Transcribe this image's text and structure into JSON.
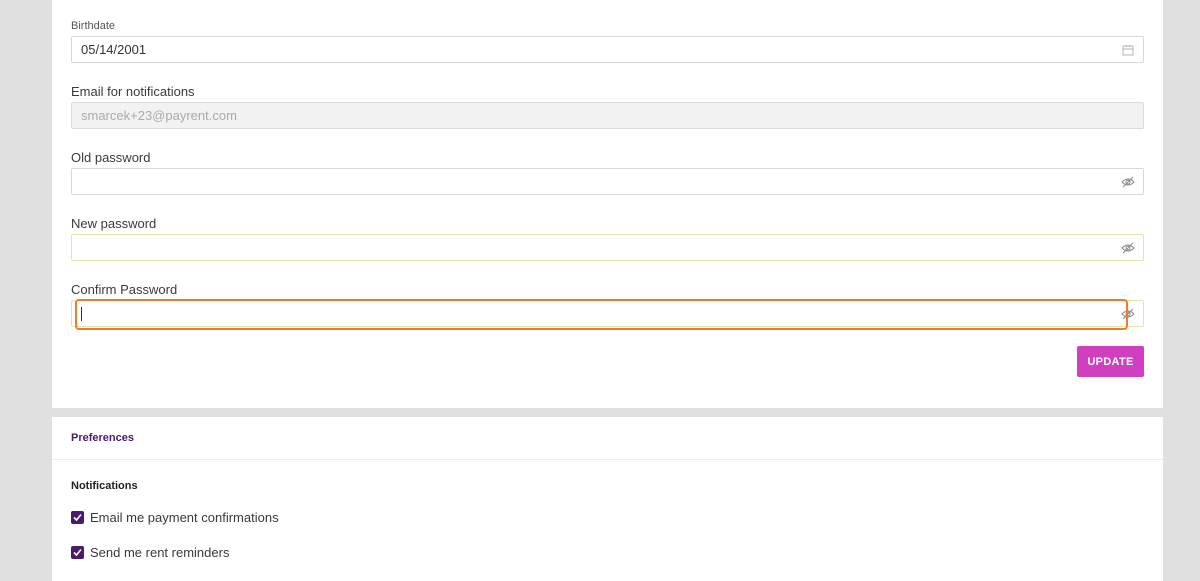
{
  "account_form": {
    "birthdate": {
      "label": "Birthdate",
      "value": "05/14/2001"
    },
    "email": {
      "label": "Email for notifications",
      "value": "smarcek+23@payrent.com"
    },
    "old_password": {
      "label": "Old password",
      "value": ""
    },
    "new_password": {
      "label": "New password",
      "value": ""
    },
    "confirm_password": {
      "label": "Confirm Password",
      "value": ""
    },
    "update_label": "UPDATE"
  },
  "preferences": {
    "title": "Preferences",
    "notifications_title": "Notifications",
    "options": [
      {
        "label": "Email me payment confirmations",
        "checked": true
      },
      {
        "label": "Send me rent reminders",
        "checked": true
      }
    ]
  },
  "colors": {
    "accent_purple": "#4b1a6b",
    "button_magenta": "#cf3fbf",
    "focus_orange": "#f07b2a"
  },
  "icons": {
    "calendar": "calendar-icon",
    "password_toggle": "eye-slash-icon",
    "checkmark": "checkmark-icon"
  }
}
